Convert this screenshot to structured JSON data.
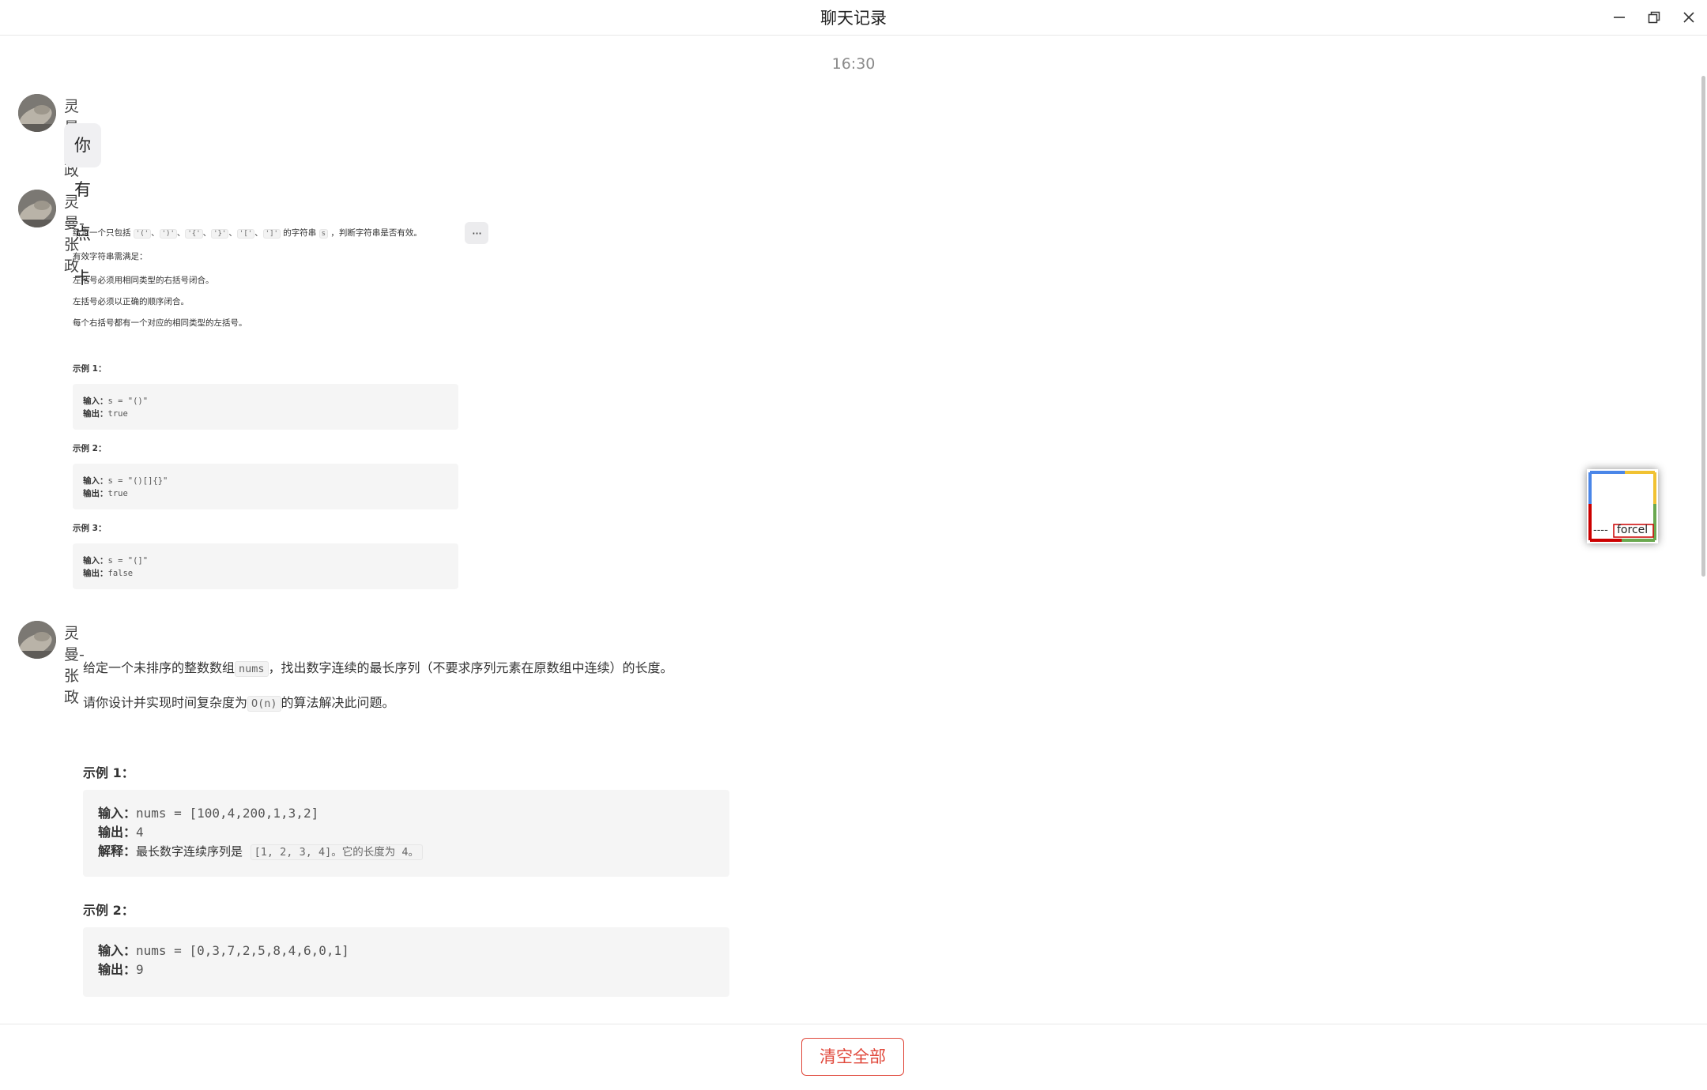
{
  "window": {
    "title": "聊天记录",
    "controls": {
      "minimize_icon": "minimize-icon",
      "restore_icon": "restore-icon",
      "close_icon": "close-icon"
    }
  },
  "chat": {
    "timestamp": "16:30",
    "messages": [
      {
        "sender": "灵曼-张政",
        "text": "你有点卡"
      },
      {
        "sender": "灵曼-张政",
        "more_label": "···",
        "intro_pre": "给定一个只包括",
        "intro_codes": [
          "'('",
          "')'",
          "'{'",
          "'}'",
          "'['",
          "']'"
        ],
        "intro_mid": "的字符串",
        "intro_var": "s",
        "intro_post": "，判断字符串是否有效。",
        "valid_title": "有效字符串需满足：",
        "rules": [
          "左括号必须用相同类型的右括号闭合。",
          "左括号必须以正确的顺序闭合。",
          "每个右括号都有一个对应的相同类型的左括号。"
        ],
        "examples": [
          {
            "title": "示例 1：",
            "input_label": "输入：",
            "input": "s = \"()\"",
            "output_label": "输出：",
            "output": "true"
          },
          {
            "title": "示例 2：",
            "input_label": "输入：",
            "input": "s = \"()[]{}\"",
            "output_label": "输出：",
            "output": "true"
          },
          {
            "title": "示例 3：",
            "input_label": "输入：",
            "input": "s = \"(]\"",
            "output_label": "输出：",
            "output": "false"
          }
        ]
      },
      {
        "sender": "灵曼-张政",
        "p1_pre": "给定一个未排序的整数数组",
        "p1_code": "nums",
        "p1_post": "，找出数字连续的最长序列（不要求序列元素在原数组中连续）的长度。",
        "p2_pre": "请你设计并实现时间复杂度为",
        "p2_code": "O(n)",
        "p2_post": "的算法解决此问题。",
        "examples": [
          {
            "title": "示例 1：",
            "input_label": "输入：",
            "input": "nums = [100,4,200,1,3,2]",
            "output_label": "输出：",
            "output": "4",
            "explain_label": "解释：",
            "explain_pre": "最长数字连续序列是",
            "explain_code": "[1, 2, 3, 4]。它的长度为 4。"
          },
          {
            "title": "示例 2：",
            "input_label": "输入：",
            "input": "nums = [0,3,7,2,5,8,4,6,0,1]",
            "output_label": "输出：",
            "output": "9"
          }
        ]
      }
    ]
  },
  "floating_widget": {
    "label": "forcel",
    "dashes": "----",
    "colors": [
      "#4a86e8",
      "#f1c232",
      "#6aa84f",
      "#cc0000"
    ]
  },
  "footer": {
    "clear_all_label": "清空全部",
    "accent_color": "#e0473a"
  }
}
